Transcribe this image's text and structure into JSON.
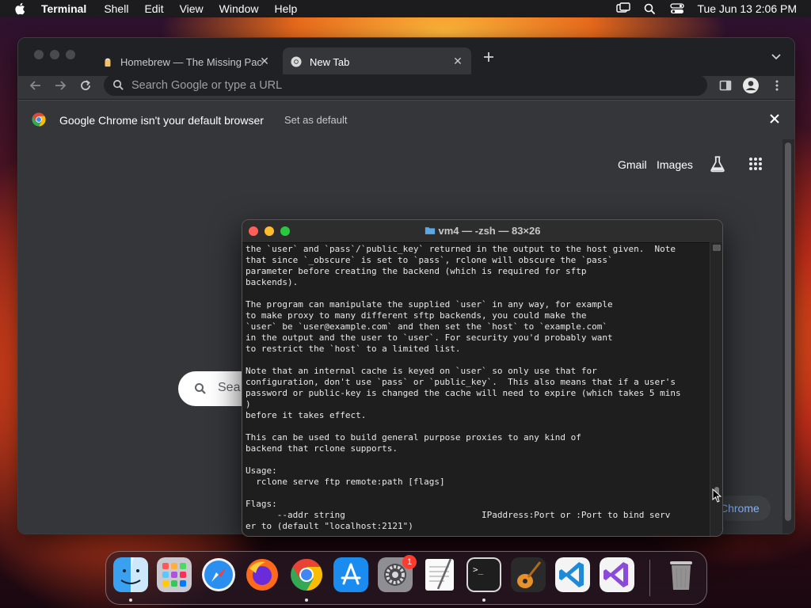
{
  "menubar": {
    "app": "Terminal",
    "items": [
      "Shell",
      "Edit",
      "View",
      "Window",
      "Help"
    ],
    "clock": "Tue Jun 13  2:06 PM",
    "status_icons": [
      "screen-mirroring-icon",
      "spotlight-search-icon",
      "control-center-icon"
    ]
  },
  "chrome": {
    "tabs": [
      {
        "label": "Homebrew — The Missing Pack",
        "icon": "homebrew-icon"
      },
      {
        "label": "New Tab",
        "icon": "chrome-icon"
      }
    ],
    "omnibox_placeholder": "Search Google or type a URL",
    "infobar": {
      "message": "Google Chrome isn't your default browser",
      "action": "Set as default"
    },
    "ntp": {
      "links": [
        "Gmail",
        "Images"
      ],
      "search_placeholder_partial": "Sea",
      "customize_partial": "Chrome"
    }
  },
  "terminal": {
    "title": "vm4 — -zsh — 83×26",
    "lines": [
      "the `user` and `pass`/`public_key` returned in the output to the host given.  Note",
      "that since `_obscure` is set to `pass`, rclone will obscure the `pass`",
      "parameter before creating the backend (which is required for sftp",
      "backends).",
      "",
      "The program can manipulate the supplied `user` in any way, for example",
      "to make proxy to many different sftp backends, you could make the",
      "`user` be `user@example.com` and then set the `host` to `example.com`",
      "in the output and the user to `user`. For security you'd probably want",
      "to restrict the `host` to a limited list.",
      "",
      "Note that an internal cache is keyed on `user` so only use that for",
      "configuration, don't use `pass` or `public_key`.  This also means that if a user's",
      "password or public-key is changed the cache will need to expire (which takes 5 mins",
      ")",
      "before it takes effect.",
      "",
      "This can be used to build general purpose proxies to any kind of",
      "backend that rclone supports.",
      "",
      "Usage:",
      "  rclone serve ftp remote:path [flags]",
      "",
      "Flags:",
      "      --addr string                          IPaddress:Port or :Port to bind serv",
      "er to (default \"localhost:2121\")"
    ]
  },
  "dock": {
    "apps": [
      {
        "name": "finder-icon",
        "running": true
      },
      {
        "name": "launchpad-icon",
        "running": false
      },
      {
        "name": "safari-icon",
        "running": false
      },
      {
        "name": "firefox-icon",
        "running": false
      },
      {
        "name": "chrome-icon",
        "running": true
      },
      {
        "name": "app-store-icon",
        "running": false
      },
      {
        "name": "system-settings-icon",
        "running": false,
        "badge": "1"
      },
      {
        "name": "textedit-icon",
        "running": false
      },
      {
        "name": "terminal-icon",
        "running": true
      },
      {
        "name": "garageband-icon",
        "running": false
      },
      {
        "name": "vscode-icon",
        "running": false
      },
      {
        "name": "visual-studio-icon",
        "running": false
      },
      {
        "name": "trash-icon",
        "running": false
      }
    ]
  }
}
